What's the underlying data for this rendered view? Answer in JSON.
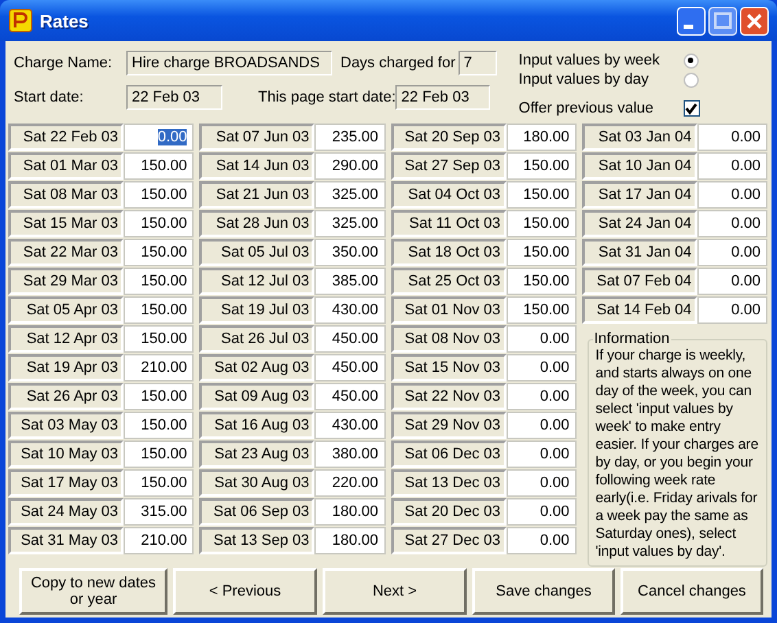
{
  "window": {
    "title": "Rates"
  },
  "header": {
    "charge_name_label": "Charge Name:",
    "charge_name": "Hire charge BROADSANDS",
    "days_label": "Days charged for",
    "days": "7",
    "start_label": "Start date:",
    "start_date": "22 Feb 03",
    "page_start_label": "This page start date:",
    "page_start_date": "22 Feb 03"
  },
  "input_modes": [
    {
      "label": "Input values by week",
      "selected": true
    },
    {
      "label": "Input values by day",
      "selected": false
    }
  ],
  "offer_previous": {
    "label": "Offer previous value",
    "checked": true
  },
  "columns": [
    [
      {
        "date": "Sat 22 Feb 03",
        "value": "0.00",
        "selected": true
      },
      {
        "date": "Sat 01 Mar 03",
        "value": "150.00",
        "selected": false
      },
      {
        "date": "Sat 08 Mar 03",
        "value": "150.00",
        "selected": false
      },
      {
        "date": "Sat 15 Mar 03",
        "value": "150.00",
        "selected": false
      },
      {
        "date": "Sat 22 Mar 03",
        "value": "150.00",
        "selected": false
      },
      {
        "date": "Sat 29 Mar 03",
        "value": "150.00",
        "selected": false
      },
      {
        "date": "Sat 05 Apr 03",
        "value": "150.00",
        "selected": false
      },
      {
        "date": "Sat 12 Apr 03",
        "value": "150.00",
        "selected": false
      },
      {
        "date": "Sat 19 Apr 03",
        "value": "210.00",
        "selected": false
      },
      {
        "date": "Sat 26 Apr 03",
        "value": "150.00",
        "selected": false
      },
      {
        "date": "Sat 03 May 03",
        "value": "150.00",
        "selected": false
      },
      {
        "date": "Sat 10 May 03",
        "value": "150.00",
        "selected": false
      },
      {
        "date": "Sat 17 May 03",
        "value": "150.00",
        "selected": false
      },
      {
        "date": "Sat 24 May 03",
        "value": "315.00",
        "selected": false
      },
      {
        "date": "Sat 31 May 03",
        "value": "210.00",
        "selected": false
      }
    ],
    [
      {
        "date": "Sat 07 Jun 03",
        "value": "235.00",
        "selected": false
      },
      {
        "date": "Sat 14 Jun 03",
        "value": "290.00",
        "selected": false
      },
      {
        "date": "Sat 21 Jun 03",
        "value": "325.00",
        "selected": false
      },
      {
        "date": "Sat 28 Jun 03",
        "value": "325.00",
        "selected": false
      },
      {
        "date": "Sat 05 Jul 03",
        "value": "350.00",
        "selected": false
      },
      {
        "date": "Sat 12 Jul 03",
        "value": "385.00",
        "selected": false
      },
      {
        "date": "Sat 19 Jul 03",
        "value": "430.00",
        "selected": false
      },
      {
        "date": "Sat 26 Jul 03",
        "value": "450.00",
        "selected": false
      },
      {
        "date": "Sat 02 Aug 03",
        "value": "450.00",
        "selected": false
      },
      {
        "date": "Sat 09 Aug 03",
        "value": "450.00",
        "selected": false
      },
      {
        "date": "Sat 16 Aug 03",
        "value": "430.00",
        "selected": false
      },
      {
        "date": "Sat 23 Aug 03",
        "value": "380.00",
        "selected": false
      },
      {
        "date": "Sat 30 Aug 03",
        "value": "220.00",
        "selected": false
      },
      {
        "date": "Sat 06 Sep 03",
        "value": "180.00",
        "selected": false
      },
      {
        "date": "Sat 13 Sep 03",
        "value": "180.00",
        "selected": false
      }
    ],
    [
      {
        "date": "Sat 20 Sep 03",
        "value": "180.00",
        "selected": false
      },
      {
        "date": "Sat 27 Sep 03",
        "value": "150.00",
        "selected": false
      },
      {
        "date": "Sat 04 Oct 03",
        "value": "150.00",
        "selected": false
      },
      {
        "date": "Sat 11 Oct 03",
        "value": "150.00",
        "selected": false
      },
      {
        "date": "Sat 18 Oct 03",
        "value": "150.00",
        "selected": false
      },
      {
        "date": "Sat 25 Oct 03",
        "value": "150.00",
        "selected": false
      },
      {
        "date": "Sat 01 Nov 03",
        "value": "150.00",
        "selected": false
      },
      {
        "date": "Sat 08 Nov 03",
        "value": "0.00",
        "selected": false
      },
      {
        "date": "Sat 15 Nov 03",
        "value": "0.00",
        "selected": false
      },
      {
        "date": "Sat 22 Nov 03",
        "value": "0.00",
        "selected": false
      },
      {
        "date": "Sat 29 Nov 03",
        "value": "0.00",
        "selected": false
      },
      {
        "date": "Sat 06 Dec 03",
        "value": "0.00",
        "selected": false
      },
      {
        "date": "Sat 13 Dec 03",
        "value": "0.00",
        "selected": false
      },
      {
        "date": "Sat 20 Dec 03",
        "value": "0.00",
        "selected": false
      },
      {
        "date": "Sat 27 Dec 03",
        "value": "0.00",
        "selected": false
      }
    ],
    [
      {
        "date": "Sat 03 Jan 04",
        "value": "0.00",
        "selected": false
      },
      {
        "date": "Sat 10 Jan 04",
        "value": "0.00",
        "selected": false
      },
      {
        "date": "Sat 17 Jan 04",
        "value": "0.00",
        "selected": false
      },
      {
        "date": "Sat 24 Jan 04",
        "value": "0.00",
        "selected": false
      },
      {
        "date": "Sat 31 Jan 04",
        "value": "0.00",
        "selected": false
      },
      {
        "date": "Sat 07 Feb 04",
        "value": "0.00",
        "selected": false
      },
      {
        "date": "Sat 14 Feb 04",
        "value": "0.00",
        "selected": false
      }
    ]
  ],
  "information": {
    "title": "Information",
    "text": "If your charge is weekly, and starts always on one day of the week, you can select 'input values by week' to make entry easier.  If your charges are by day, or you begin your following week rate early(i.e. Friday arivals for a week pay the same as Saturday ones), select 'input values by day'."
  },
  "buttons": [
    "Copy to new dates or year",
    "< Previous",
    "Next >",
    "Save changes",
    "Cancel changes"
  ]
}
